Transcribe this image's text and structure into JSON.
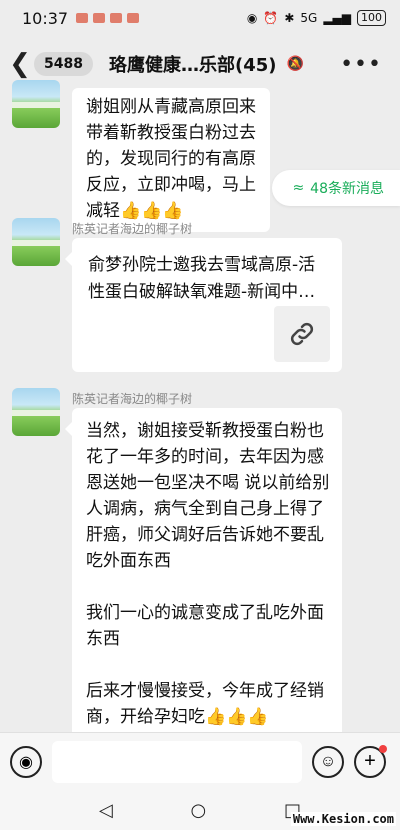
{
  "status_bar": {
    "time": "10:37",
    "signal_text": "5G",
    "battery": "100"
  },
  "header": {
    "unread_count": "5488",
    "title": "珞鹰健康…乐部(45)"
  },
  "new_messages": "48条新消息",
  "messages": [
    {
      "text": "谢姐刚从青藏高原回来 带着靳教授蛋白粉过去的，发现同行的有高原反应，立即冲喝，马上减轻👍👍👍"
    },
    {
      "sender": "陈英记者海边的椰子树",
      "link_title": "俞梦孙院士邀我去雪域高原-活性蛋白破解缺氧难题-新闻中心-珞鹰健康"
    },
    {
      "sender": "陈英记者海边的椰子树",
      "paragraphs": [
        "当然，谢姐接受靳教授蛋白粉也花了一年多的时间，去年因为感恩送她一包坚决不喝 说以前给别人调病，病气全到自己身上得了肝癌，师父调好后告诉她不要乱吃外面东西",
        "我们一心的诚意变成了乱吃外面东西",
        "后来才慢慢接受，今年成了经销商，开给孕妇吃👍👍👍"
      ]
    }
  ],
  "watermark": "Www.Kesion.com",
  "icons": {
    "back": "chevron-left-icon",
    "mute": "bell-off-icon",
    "more": "more-icon",
    "link": "link-icon",
    "voice": "voice-icon",
    "emoji": "emoji-icon",
    "plus": "plus-icon"
  },
  "colors": {
    "accent": "#1aad5a",
    "background": "#ededed"
  }
}
